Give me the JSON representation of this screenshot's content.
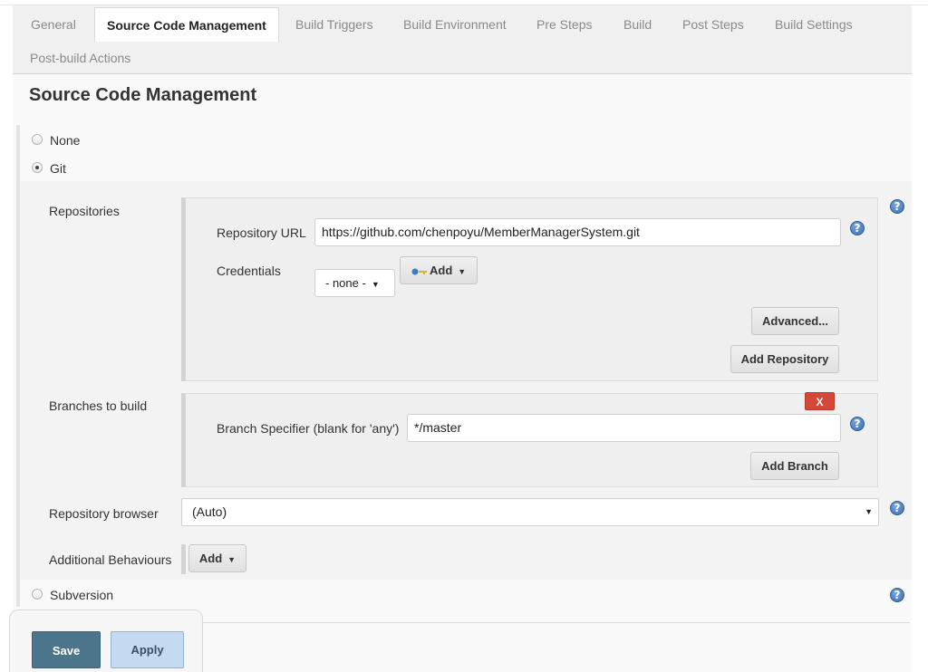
{
  "tabs": {
    "general": "General",
    "scm": "Source Code Management",
    "build_triggers": "Build Triggers",
    "build_environment": "Build Environment",
    "pre_steps": "Pre Steps",
    "build": "Build",
    "post_steps": "Post Steps",
    "build_settings": "Build Settings",
    "post_build_actions": "Post-build Actions",
    "active": "Source Code Management"
  },
  "section": {
    "title": "Source Code Management"
  },
  "scm_options": {
    "none": "None",
    "git": "Git",
    "subversion": "Subversion",
    "selected": "Git"
  },
  "git": {
    "repositories_label": "Repositories",
    "repository_url_label": "Repository URL",
    "repository_url_value": "https://github.com/chenpoyu/MemberManagerSystem.git",
    "credentials_label": "Credentials",
    "credentials_value": "- none -",
    "add_credentials_label": "Add",
    "advanced_label": "Advanced...",
    "add_repository_label": "Add Repository",
    "branches_label": "Branches to build",
    "delete_branch_label": "X",
    "branch_specifier_label": "Branch Specifier (blank for 'any')",
    "branch_specifier_value": "*/master",
    "add_branch_label": "Add Branch",
    "repository_browser_label": "Repository browser",
    "repository_browser_value": "(Auto)",
    "additional_behaviours_label": "Additional Behaviours",
    "additional_behaviours_add": "Add"
  },
  "help_icon": "?",
  "footer": {
    "save_label": "Save",
    "apply_label": "Apply",
    "obscured_heading_fragment": "ig"
  },
  "icons": {
    "help": "help-icon",
    "key": "key-icon",
    "dropdown": "caret-down-icon"
  },
  "colors": {
    "save_button": "#4b758b",
    "apply_button": "#c4daf0",
    "delete_button": "#d24939",
    "help_icon": "#3a6fb0"
  }
}
